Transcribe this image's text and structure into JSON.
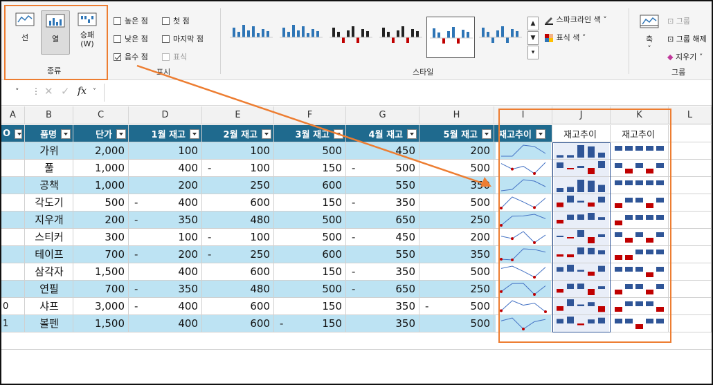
{
  "ribbon": {
    "type_group": {
      "label": "종류",
      "buttons": [
        {
          "label": "선"
        },
        {
          "label": "열"
        },
        {
          "label": "승패\n(W)"
        }
      ]
    },
    "show_group": {
      "label": "표시",
      "checks": [
        {
          "label": "높은 점",
          "checked": false,
          "disabled": false
        },
        {
          "label": "첫 점",
          "checked": false,
          "disabled": false
        },
        {
          "label": "낮은 점",
          "checked": false,
          "disabled": false
        },
        {
          "label": "마지막 점",
          "checked": false,
          "disabled": false
        },
        {
          "label": "음수 점",
          "checked": true,
          "disabled": false
        },
        {
          "label": "표식",
          "checked": false,
          "disabled": true
        }
      ]
    },
    "style_group": {
      "label": "스타일",
      "sparkline_color": "스파크라인 색",
      "marker_color": "표식 색"
    },
    "group_group": {
      "label": "그룹",
      "axis": "축",
      "group": "그룹",
      "ungroup": "그룹 해제",
      "clear": "지우기"
    }
  },
  "formula_bar": {
    "fx": "fx",
    "name_box": "",
    "content": ""
  },
  "columns": [
    "A",
    "B",
    "C",
    "D",
    "E",
    "F",
    "G",
    "H",
    "I",
    "J",
    "K",
    "L"
  ],
  "header_row": [
    "O",
    "품명",
    "단가",
    "1월 재고",
    "2월 재고",
    "3월 재고",
    "4월 재고",
    "5월 재고",
    "재고추이",
    "재고추이",
    "재고추이"
  ],
  "row_numbers": [
    "",
    "",
    "",
    "",
    "",
    "",
    "",
    "",
    "",
    "0",
    "1"
  ],
  "rows": [
    {
      "name": "가위",
      "price": "2,000",
      "m": [
        "100",
        "100",
        "500",
        "450",
        "200"
      ],
      "neg": [
        false,
        false,
        false,
        false,
        false
      ]
    },
    {
      "name": "풀",
      "price": "1,000",
      "m": [
        "400",
        "100",
        "150",
        "500",
        "500"
      ],
      "neg": [
        false,
        true,
        false,
        true,
        false
      ]
    },
    {
      "name": "공책",
      "price": "1,000",
      "m": [
        "200",
        "250",
        "600",
        "550",
        "350"
      ],
      "neg": [
        false,
        false,
        false,
        false,
        false
      ]
    },
    {
      "name": "각도기",
      "price": "500",
      "m": [
        "400",
        "600",
        "150",
        "350",
        "500"
      ],
      "neg": [
        true,
        false,
        false,
        true,
        false
      ]
    },
    {
      "name": "지우개",
      "price": "200",
      "m": [
        "350",
        "480",
        "500",
        "650",
        "250"
      ],
      "neg": [
        true,
        false,
        false,
        false,
        false
      ]
    },
    {
      "name": "스티커",
      "price": "300",
      "m": [
        "100",
        "100",
        "500",
        "450",
        "200"
      ],
      "neg": [
        false,
        true,
        false,
        true,
        false
      ]
    },
    {
      "name": "테이프",
      "price": "700",
      "m": [
        "200",
        "250",
        "600",
        "550",
        "350"
      ],
      "neg": [
        true,
        true,
        false,
        false,
        false
      ]
    },
    {
      "name": "삼각자",
      "price": "1,500",
      "m": [
        "400",
        "600",
        "150",
        "350",
        "500"
      ],
      "neg": [
        false,
        false,
        false,
        true,
        false
      ]
    },
    {
      "name": "연필",
      "price": "700",
      "m": [
        "350",
        "480",
        "500",
        "650",
        "250"
      ],
      "neg": [
        true,
        false,
        false,
        true,
        false
      ]
    },
    {
      "name": "샤프",
      "price": "3,000",
      "m": [
        "400",
        "600",
        "150",
        "350",
        "500"
      ],
      "neg": [
        true,
        false,
        false,
        false,
        true
      ]
    },
    {
      "name": "볼펜",
      "price": "1,500",
      "m": [
        "400",
        "600",
        "150",
        "350",
        "500"
      ],
      "neg": [
        false,
        false,
        true,
        false,
        false
      ]
    }
  ],
  "colors": {
    "header_bg": "#1f6a8e",
    "band": "#bde3f3",
    "spark_line": "#4472c4",
    "spark_bar": "#2f5597",
    "negative": "#c00000",
    "highlight": "#ed7d31"
  }
}
